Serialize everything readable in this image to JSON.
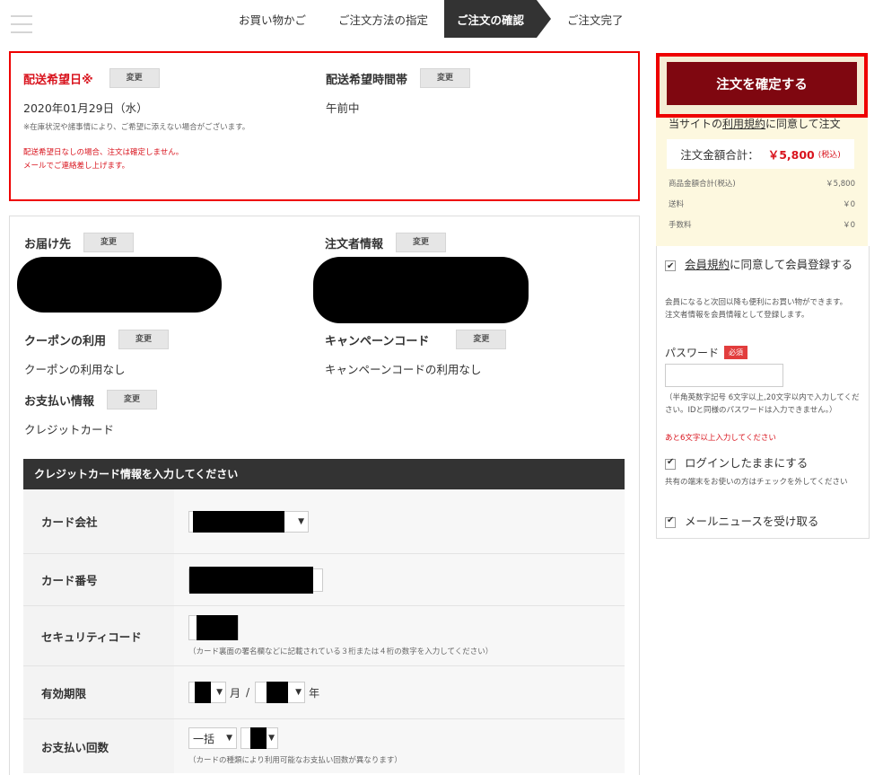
{
  "nav": {
    "steps": [
      "お買い物かご",
      "ご注文方法の指定",
      "ご注文の確認",
      "ご注文完了"
    ]
  },
  "delivery": {
    "date_title": "配送希望日※",
    "date_change": "変更",
    "date_value": "2020年01月29日（水）",
    "date_note": "※在庫状況や諸事情により、ご希望に添えない場合がございます。",
    "red_note_1": "配送希望日なしの場合、注文は確定しません。",
    "red_note_2": "メールでご連絡差し上げます。",
    "time_title": "配送希望時間帯",
    "time_change": "変更",
    "time_value": "午前中"
  },
  "info": {
    "shipto_title": "お届け先",
    "shipto_change": "変更",
    "orderer_title": "注文者情報",
    "orderer_change": "変更",
    "coupon_title": "クーポンの利用",
    "coupon_change": "変更",
    "coupon_value": "クーポンの利用なし",
    "campaign_title": "キャンペーンコード",
    "campaign_change": "変更",
    "campaign_value": "キャンペーンコードの利用なし",
    "payment_title": "お支払い情報",
    "payment_change": "変更",
    "payment_value": "クレジットカード"
  },
  "cc": {
    "header": "クレジットカード情報を入力してください",
    "company_label": "カード会社",
    "number_label": "カード番号",
    "security_label": "セキュリティコード",
    "security_hint": "（カード裏面の署名欄などに記載されている３桁または４桁の数字を入力してください）",
    "expiry_label": "有効期限",
    "month_unit": "月",
    "slash": "/",
    "year_unit": "年",
    "installments_label": "お支払い回数",
    "installments_value": "一括",
    "installments_hint": "（カードの種類により利用可能なお支払い回数が異なります）"
  },
  "sidebar": {
    "confirm_button": "注文を確定する",
    "terms_prefix": "当サイトの",
    "terms_link": "利用規約",
    "terms_suffix": "に同意して注文",
    "total_label": "注文金額合計：",
    "total_value": "￥5,800",
    "total_tax": "(税込)",
    "subtotal_label": "商品金額合計(税込)",
    "subtotal_value": "￥5,800",
    "shipping_label": "送料",
    "shipping_value": "￥0",
    "fee_label": "手数料",
    "fee_value": "￥0",
    "member_link": "会員規約",
    "member_text": "に同意して会員登録する",
    "member_note_1": "会員になると次回以降も便利にお買い物ができます。",
    "member_note_2": "注文者情報を会員情報として登録します。",
    "password_label": "パスワード",
    "required_badge": "必須",
    "password_hint": "（半角英数字記号 6文字以上,20文字以内で入力してください。IDと同様のパスワードは入力できません。）",
    "password_remaining": "あと6文字以上入力してください",
    "stay_login": "ログインしたままにする",
    "stay_login_note": "共有の端末をお使いの方はチェックを外してください",
    "newsletter": "メールニュースを受け取る"
  }
}
